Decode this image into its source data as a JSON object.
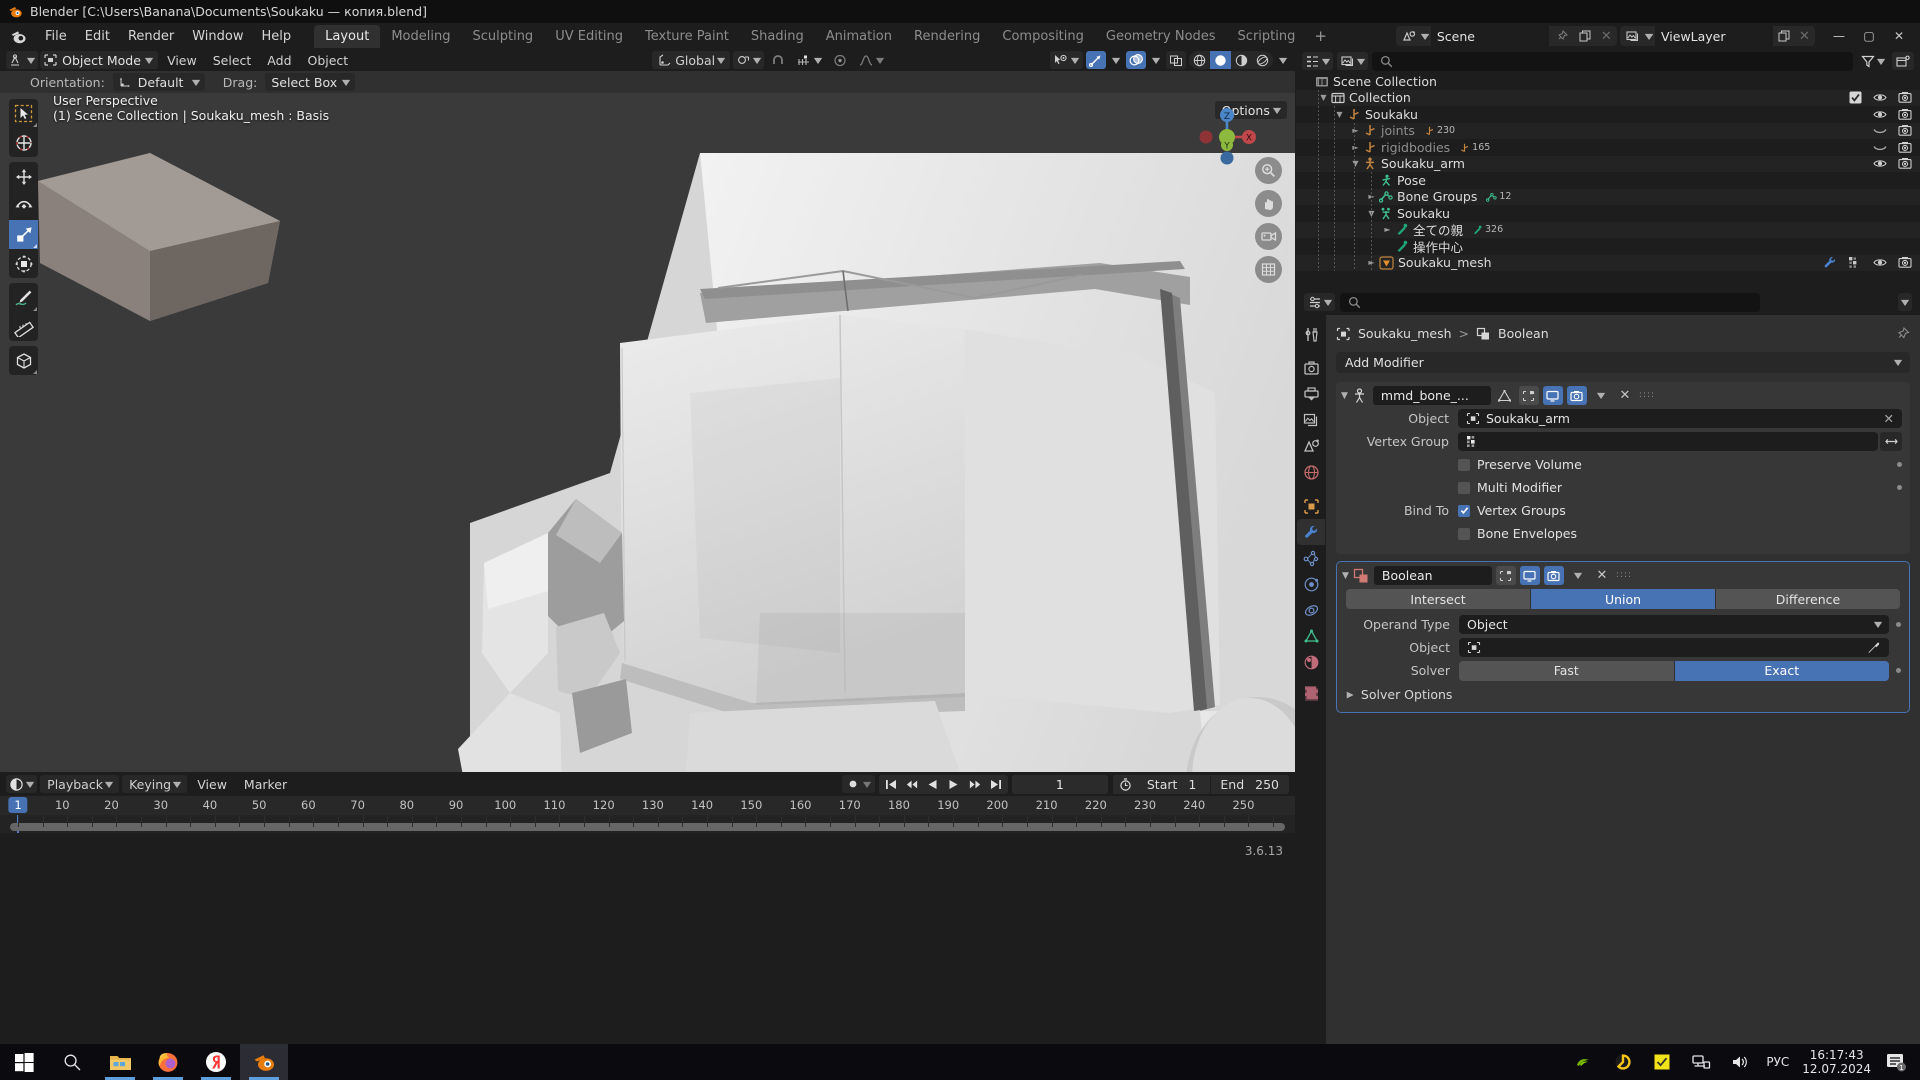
{
  "window": {
    "title": "Blender [C:\\Users\\Banana\\Documents\\Soukaku — копия.blend]",
    "minimize": "—",
    "maximize": "▢",
    "close": "✕"
  },
  "topbar": {
    "menus": [
      "File",
      "Edit",
      "Render",
      "Window",
      "Help"
    ],
    "workspaces": [
      "Layout",
      "Modeling",
      "Sculpting",
      "UV Editing",
      "Texture Paint",
      "Shading",
      "Animation",
      "Rendering",
      "Compositing",
      "Geometry Nodes",
      "Scripting"
    ],
    "active_workspace": "Layout",
    "add_workspace": "+",
    "scene_name": "Scene",
    "viewlayer_name": "ViewLayer"
  },
  "viewport_header": {
    "mode": "Object Mode",
    "menus": [
      "View",
      "Select",
      "Add",
      "Object"
    ],
    "transform_orientation": "Global"
  },
  "tool_settings": {
    "orientation_label": "Orientation:",
    "orientation_value": "Default",
    "drag_label": "Drag:",
    "drag_value": "Select Box"
  },
  "viewport": {
    "options_label": "Options",
    "perspective": "User Perspective",
    "breadcrumb": "(1) Scene Collection | Soukaku_mesh : Basis",
    "gizmo_axes": [
      "Z",
      "Y",
      "X"
    ],
    "tools": [
      {
        "name": "tweak-tool",
        "label": "Tweak"
      },
      {
        "name": "cursor-tool",
        "label": "Cursor"
      },
      {
        "name": "move-tool",
        "label": "Move"
      },
      {
        "name": "rotate-tool",
        "label": "Rotate"
      },
      {
        "name": "scale-tool",
        "label": "Scale",
        "active": true
      },
      {
        "name": "transform-tool",
        "label": "Transform"
      },
      {
        "name": "annotate-tool",
        "label": "Annotate"
      },
      {
        "name": "measure-tool",
        "label": "Measure"
      },
      {
        "name": "add-cube-tool",
        "label": "Add Cube"
      }
    ]
  },
  "outliner": {
    "display_mode": "View Layer",
    "search_placeholder": "",
    "rows": [
      {
        "indent": 0,
        "tri": "",
        "icon": "scene-collection-icon",
        "label": "Scene Collection",
        "dim": false,
        "count": "",
        "checkbox": false,
        "eye": false,
        "camera": false
      },
      {
        "indent": 1,
        "tri": "▼",
        "icon": "collection-icon",
        "label": "Collection",
        "dim": false,
        "count": "",
        "checkbox": true,
        "eye": true,
        "camera": true
      },
      {
        "indent": 2,
        "tri": "▼",
        "icon": "empty-axis-icon",
        "label": "Soukaku",
        "dim": false,
        "count": "",
        "checkbox": false,
        "eye": true,
        "camera": true
      },
      {
        "indent": 3,
        "tri": "►",
        "icon": "empty-axis-icon",
        "label": "joints",
        "dim": true,
        "count": "230",
        "checkbox": false,
        "eye": "closed",
        "camera": true
      },
      {
        "indent": 3,
        "tri": "►",
        "icon": "empty-axis-icon",
        "label": "rigidbodies",
        "dim": true,
        "count": "165",
        "checkbox": false,
        "eye": "closed",
        "camera": true
      },
      {
        "indent": 3,
        "tri": "▼",
        "icon": "armature-icon",
        "label": "Soukaku_arm",
        "dim": false,
        "count": "",
        "checkbox": false,
        "eye": true,
        "camera": true
      },
      {
        "indent": 4,
        "tri": "",
        "icon": "pose-icon",
        "label": "Pose",
        "dim": false,
        "count": "",
        "checkbox": false,
        "eye": false,
        "camera": false
      },
      {
        "indent": 4,
        "tri": "►",
        "icon": "bone-groups-icon",
        "label": "Bone Groups",
        "dim": false,
        "count": "12",
        "checkbox": false,
        "eye": false,
        "camera": false
      },
      {
        "indent": 4,
        "tri": "▼",
        "icon": "armature-data-icon",
        "label": "Soukaku",
        "dim": false,
        "count": "",
        "checkbox": false,
        "eye": false,
        "camera": false
      },
      {
        "indent": 5,
        "tri": "►",
        "icon": "bone-icon",
        "label": "全ての親",
        "dim": false,
        "count": "326",
        "checkbox": false,
        "eye": false,
        "camera": false
      },
      {
        "indent": 5,
        "tri": "",
        "icon": "bone-icon",
        "label": "操作中心",
        "dim": false,
        "count": "",
        "checkbox": false,
        "eye": false,
        "camera": false
      },
      {
        "indent": 4,
        "tri": "►",
        "icon": "mesh-data-icon",
        "label": "Soukaku_mesh",
        "dim": false,
        "count": "",
        "checkbox": false,
        "eye": true,
        "camera": true,
        "modifier": true
      }
    ]
  },
  "properties": {
    "breadcrumb_object": "Soukaku_mesh",
    "breadcrumb_separator": ">",
    "breadcrumb_modifier": "Boolean",
    "add_modifier": "Add Modifier",
    "modifiers": [
      {
        "name": "mmd_bone_...",
        "type": "armature",
        "selected": false,
        "rows": [
          {
            "kind": "field",
            "label": "Object",
            "value": "Soukaku_arm",
            "icon": "object-icon",
            "clear": "✕"
          },
          {
            "kind": "field",
            "label": "Vertex Group",
            "value": "",
            "icon": "vertex-group-icon",
            "invert": "↔"
          },
          {
            "kind": "check",
            "label": "Preserve Volume",
            "checked": false,
            "dot": true
          },
          {
            "kind": "check",
            "label": "Multi Modifier",
            "checked": false,
            "dot": true
          },
          {
            "kind": "check",
            "label": "Vertex Groups",
            "checked": true,
            "prefix": "Bind To"
          },
          {
            "kind": "check",
            "label": "Bone Envelopes",
            "checked": false
          }
        ]
      },
      {
        "name": "Boolean",
        "type": "boolean",
        "selected": true,
        "operations": [
          "Intersect",
          "Union",
          "Difference"
        ],
        "active_operation": "Union",
        "operand_type_label": "Operand Type",
        "operand_type_value": "Object",
        "object_label": "Object",
        "object_value": "",
        "solver_label": "Solver",
        "solvers": [
          "Fast",
          "Exact"
        ],
        "active_solver": "Exact",
        "solver_options": "Solver Options"
      }
    ]
  },
  "timeline": {
    "menus": [
      "Playback",
      "Keying",
      "View",
      "Marker"
    ],
    "current_frame": "1",
    "start_label": "Start",
    "start_value": "1",
    "end_label": "End",
    "end_value": "250",
    "ticks": [
      1,
      10,
      20,
      30,
      40,
      50,
      60,
      70,
      80,
      90,
      100,
      110,
      120,
      130,
      140,
      150,
      160,
      170,
      180,
      190,
      200,
      210,
      220,
      230,
      240,
      250
    ],
    "playhead": 1,
    "range_min": 1,
    "range_max": 256
  },
  "statusbar": {
    "version": "3.6.13"
  },
  "taskbar": {
    "items": [
      {
        "name": "start-button",
        "label": "Start"
      },
      {
        "name": "search-button",
        "label": "Search"
      },
      {
        "name": "file-explorer-button",
        "label": "File Explorer",
        "running": true
      },
      {
        "name": "firefox-button",
        "label": "Firefox",
        "running": true
      },
      {
        "name": "yandex-button",
        "label": "Yandex Browser",
        "running": true
      },
      {
        "name": "blender-button",
        "label": "Blender",
        "running": true,
        "active": true
      }
    ],
    "language": "РУС",
    "time": "16:17:43",
    "date": "12.07.2024",
    "notification_count": "1"
  },
  "colors": {
    "accent": "#4772b3",
    "panel": "#303030",
    "dark": "#1d1d1d",
    "orange": "#e87d0d"
  }
}
